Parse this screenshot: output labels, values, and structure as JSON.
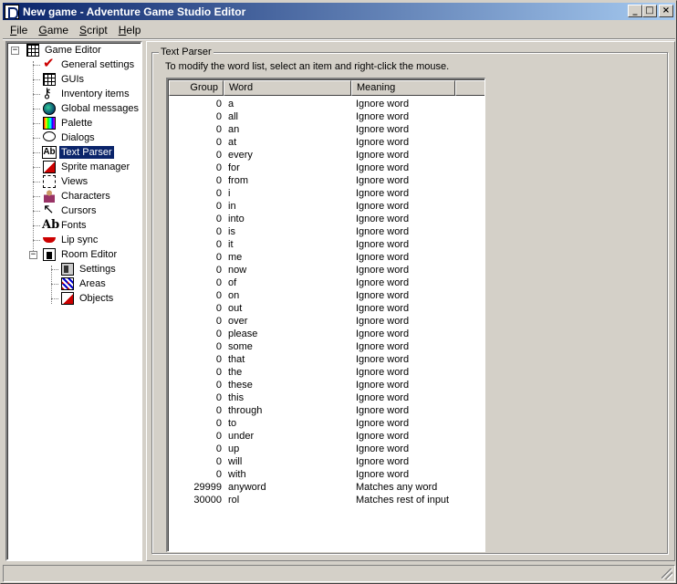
{
  "window": {
    "title": "New game - Adventure Game Studio Editor",
    "caption_buttons": {
      "minimize": "_",
      "maximize": "□",
      "close": "×"
    }
  },
  "menu": [
    {
      "label": "File",
      "accel": "F",
      "rest": "ile"
    },
    {
      "label": "Game",
      "accel": "G",
      "rest": "ame"
    },
    {
      "label": "Script",
      "accel": "S",
      "rest": "cript"
    },
    {
      "label": "Help",
      "accel": "H",
      "rest": "elp"
    }
  ],
  "tree": {
    "root": {
      "label": "Game Editor",
      "expander": "−",
      "icon": "game-editor-icon"
    },
    "items": [
      {
        "label": "General settings",
        "icon": "checkmark-icon"
      },
      {
        "label": "GUIs",
        "icon": "gui-grid-icon"
      },
      {
        "label": "Inventory items",
        "icon": "key-icon"
      },
      {
        "label": "Global messages",
        "icon": "globe-icon"
      },
      {
        "label": "Palette",
        "icon": "palette-icon"
      },
      {
        "label": "Dialogs",
        "icon": "speech-bubble-icon"
      },
      {
        "label": "Text Parser",
        "icon": "ab-text-icon",
        "selected": true
      },
      {
        "label": "Sprite manager",
        "icon": "sprite-icon"
      },
      {
        "label": "Views",
        "icon": "views-icon"
      },
      {
        "label": "Characters",
        "icon": "characters-icon"
      },
      {
        "label": "Cursors",
        "icon": "cursor-icon"
      },
      {
        "label": "Fonts",
        "icon": "fonts-icon"
      },
      {
        "label": "Lip sync",
        "icon": "lips-icon"
      }
    ],
    "room_editor": {
      "label": "Room Editor",
      "expander": "−",
      "icon": "room-editor-icon"
    },
    "room_items": [
      {
        "label": "Settings",
        "icon": "room-settings-icon"
      },
      {
        "label": "Areas",
        "icon": "areas-icon"
      },
      {
        "label": "Objects",
        "icon": "objects-icon"
      }
    ]
  },
  "parser": {
    "group_title": "Text Parser",
    "hint": "To modify the word list, select an item and right-click the mouse.",
    "columns": {
      "group": "Group",
      "word": "Word",
      "meaning": "Meaning"
    },
    "rows": [
      {
        "group": "0",
        "word": "a",
        "meaning": "Ignore word"
      },
      {
        "group": "0",
        "word": "all",
        "meaning": "Ignore word"
      },
      {
        "group": "0",
        "word": "an",
        "meaning": "Ignore word"
      },
      {
        "group": "0",
        "word": "at",
        "meaning": "Ignore word"
      },
      {
        "group": "0",
        "word": "every",
        "meaning": "Ignore word"
      },
      {
        "group": "0",
        "word": "for",
        "meaning": "Ignore word"
      },
      {
        "group": "0",
        "word": "from",
        "meaning": "Ignore word"
      },
      {
        "group": "0",
        "word": "i",
        "meaning": "Ignore word"
      },
      {
        "group": "0",
        "word": "in",
        "meaning": "Ignore word"
      },
      {
        "group": "0",
        "word": "into",
        "meaning": "Ignore word"
      },
      {
        "group": "0",
        "word": "is",
        "meaning": "Ignore word"
      },
      {
        "group": "0",
        "word": "it",
        "meaning": "Ignore word"
      },
      {
        "group": "0",
        "word": "me",
        "meaning": "Ignore word"
      },
      {
        "group": "0",
        "word": "now",
        "meaning": "Ignore word"
      },
      {
        "group": "0",
        "word": "of",
        "meaning": "Ignore word"
      },
      {
        "group": "0",
        "word": "on",
        "meaning": "Ignore word"
      },
      {
        "group": "0",
        "word": "out",
        "meaning": "Ignore word"
      },
      {
        "group": "0",
        "word": "over",
        "meaning": "Ignore word"
      },
      {
        "group": "0",
        "word": "please",
        "meaning": "Ignore word"
      },
      {
        "group": "0",
        "word": "some",
        "meaning": "Ignore word"
      },
      {
        "group": "0",
        "word": "that",
        "meaning": "Ignore word"
      },
      {
        "group": "0",
        "word": "the",
        "meaning": "Ignore word"
      },
      {
        "group": "0",
        "word": "these",
        "meaning": "Ignore word"
      },
      {
        "group": "0",
        "word": "this",
        "meaning": "Ignore word"
      },
      {
        "group": "0",
        "word": "through",
        "meaning": "Ignore word"
      },
      {
        "group": "0",
        "word": "to",
        "meaning": "Ignore word"
      },
      {
        "group": "0",
        "word": "under",
        "meaning": "Ignore word"
      },
      {
        "group": "0",
        "word": "up",
        "meaning": "Ignore word"
      },
      {
        "group": "0",
        "word": "will",
        "meaning": "Ignore word"
      },
      {
        "group": "0",
        "word": "with",
        "meaning": "Ignore word"
      },
      {
        "group": "29999",
        "word": "anyword",
        "meaning": "Matches any word"
      },
      {
        "group": "30000",
        "word": "rol",
        "meaning": "Matches rest of input"
      }
    ]
  },
  "colors": {
    "face": "#d4d0c8",
    "title_start": "#0a246a",
    "title_end": "#a6caf0",
    "selection": "#0a246a"
  }
}
